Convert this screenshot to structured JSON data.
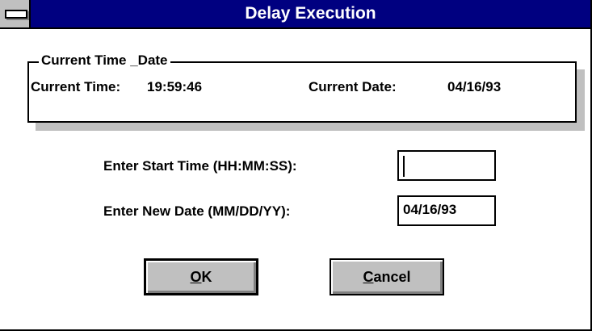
{
  "window": {
    "title": "Delay Execution"
  },
  "group": {
    "label": "Current Time _Date",
    "current_time_label": "Current Time:",
    "current_time_value": "19:59:46",
    "current_date_label": "Current Date:",
    "current_date_value": "04/16/93"
  },
  "form": {
    "start_time_label": "Enter Start Time (HH:MM:SS):",
    "start_time_value": "",
    "new_date_label": "Enter New Date (MM/DD/YY):",
    "new_date_value": "04/16/93"
  },
  "buttons": {
    "ok": {
      "mnemonic": "O",
      "rest": "K"
    },
    "cancel": {
      "mnemonic": "C",
      "rest": "ancel"
    }
  },
  "colors": {
    "titlebar": "#000080",
    "button_face": "#c0c0c0"
  },
  "icons": {
    "system_menu": "system-menu-bar-icon"
  }
}
